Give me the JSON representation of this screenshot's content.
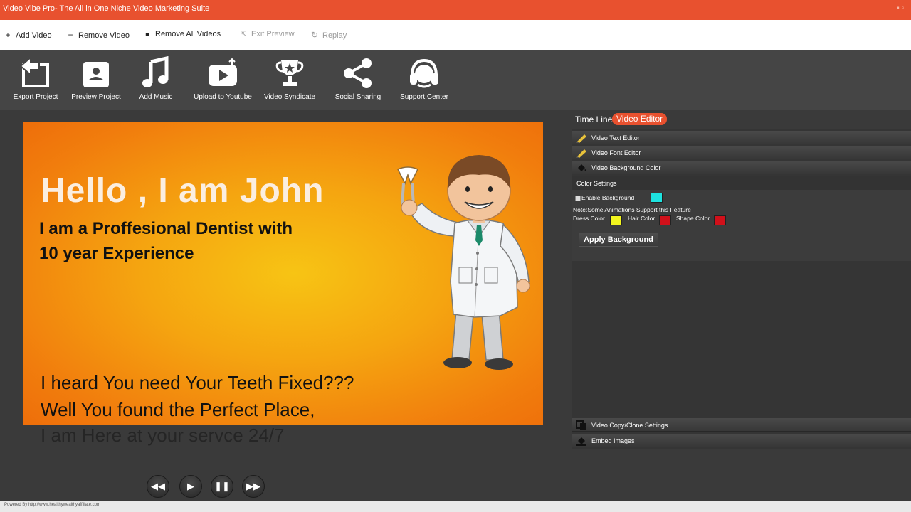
{
  "window": {
    "title": "Video Vibe Pro- The All in One Niche Video Marketing Suite"
  },
  "menu": {
    "add_video": "Add Video",
    "remove_video": "Remove Video",
    "remove_all": "Remove  All  Videos",
    "exit_preview": "Exit Preview",
    "replay": "Replay"
  },
  "toolbar": {
    "export": "Export  Project",
    "preview": "Preview  Project",
    "music": "Add  Music",
    "youtube": "Upload to Youtube",
    "syndicate": "Video Syndicate",
    "social": "Social  Sharing",
    "support": "Support Center"
  },
  "preview": {
    "headline": "Hello , I am John",
    "line1": "I am a  Proffesional Dentist with",
    "line2": "10 year Experience",
    "line3": "I heard You need Your Teeth Fixed???",
    "line4": "Well You found the Perfect Place,",
    "line5": "I am Here at  your servce 24/7"
  },
  "tabs": {
    "timeline": "Time Line",
    "editor": "Video Editor"
  },
  "panel": {
    "text_editor": "Video Text Editor",
    "font_editor": "Video Font Editor",
    "bg_color": "Video Background Color",
    "color_settings": "Color Settings",
    "enable_bg": "Enable Background",
    "note": "Note:Some Animations Support this Feature",
    "dress_color": "Dress Color",
    "hair_color": "Hair Color",
    "shape_color": "Shape Color",
    "apply": "Apply Background",
    "copy_clone": "Video Copy/Clone Settings",
    "embed": "Embed Images"
  },
  "colors": {
    "background_swatch": "#1ee3e0",
    "dress_swatch": "#f2f51e",
    "hair_swatch": "#d1101a",
    "shape_swatch": "#d1101a",
    "accent": "#e8512f"
  },
  "footer": {
    "powered": "Powered By http://www.healthywealthyaffiliate.com"
  }
}
